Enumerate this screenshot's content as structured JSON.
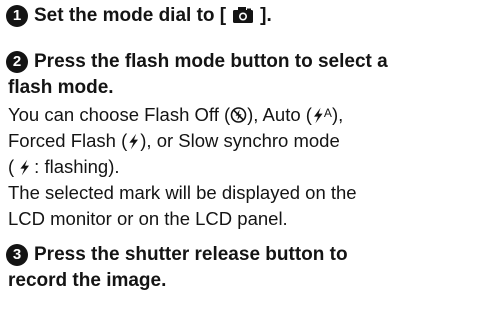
{
  "steps": [
    {
      "number": "1",
      "title_lines": [
        "Set the mode dial to [",
        "]."
      ],
      "camera_icon": "camera-icon"
    },
    {
      "number": "2",
      "title_lines": [
        "Press the flash mode button to select a",
        "flash mode."
      ],
      "body": {
        "line1_a": "You can choose Flash Off (",
        "line1_b": "), Auto (",
        "line1_c": "),",
        "line2_a": "Forced Flash (",
        "line2_b": "), or Slow synchro mode",
        "line3_a": "(",
        "line3_b": ": flashing).",
        "line4": "The selected mark will be displayed on the",
        "line5": "LCD monitor or on the LCD panel.",
        "auto_suffix": "A"
      },
      "icons": [
        "flash-off-icon",
        "flash-auto-icon",
        "flash-icon"
      ]
    },
    {
      "number": "3",
      "title_lines": [
        "Press the shutter release button to",
        "record the image."
      ]
    }
  ],
  "colors": {
    "text": "#141414",
    "background": "#ffffff"
  }
}
